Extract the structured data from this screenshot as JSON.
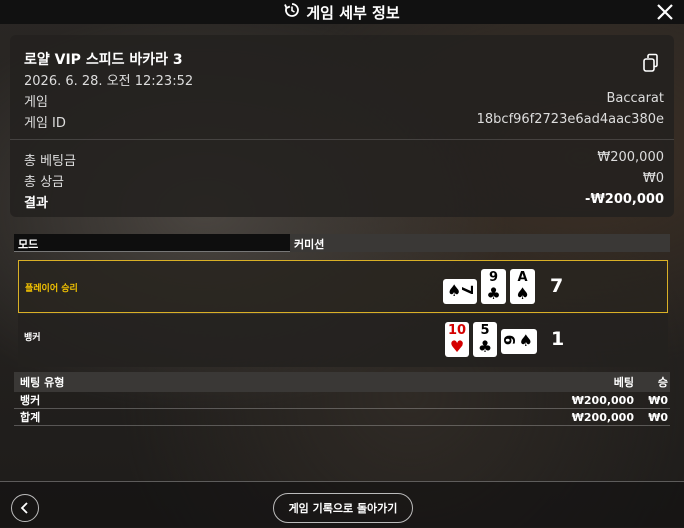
{
  "header": {
    "title": "게임 세부 정보",
    "history_icon": "history-icon",
    "close_icon": "close-icon"
  },
  "game": {
    "name": "로얄 VIP 스피드 바카라 3",
    "datetime": "2026. 6. 28. 오전 12:23:52",
    "game_label": "게임",
    "game_value": "Baccarat",
    "id_label": "게임 ID",
    "id_value": "18bcf96f2723e6ad4aac380e",
    "total_bet_label": "총 베팅금",
    "total_bet_value": "₩200,000",
    "total_win_label": "총 상금",
    "total_win_value": "₩0",
    "result_label": "결과",
    "result_value": "-₩200,000"
  },
  "tabs": {
    "mode": "모드",
    "commission": "커미션"
  },
  "hands": {
    "player": {
      "label": "플레이어 승리",
      "score": "7",
      "cards": [
        {
          "rank": "7",
          "suit": "♠",
          "color": "#000",
          "rotated": true
        },
        {
          "rank": "9",
          "suit": "♣",
          "color": "#000"
        },
        {
          "rank": "A",
          "suit": "♠",
          "color": "#000"
        }
      ]
    },
    "banker": {
      "label": "뱅커",
      "score": "1",
      "cards": [
        {
          "rank": "10",
          "suit": "♥",
          "color": "#d40000"
        },
        {
          "rank": "5",
          "suit": "♣",
          "color": "#000"
        },
        {
          "rank": "6",
          "suit": "♠",
          "color": "#000",
          "rotated": true
        }
      ]
    }
  },
  "bets": {
    "headers": {
      "type": "베팅 유형",
      "bet": "베팅",
      "win": "승"
    },
    "rows": [
      {
        "type": "뱅커",
        "bet": "₩200,000",
        "win": "₩0"
      },
      {
        "type": "합계",
        "bet": "₩200,000",
        "win": "₩0"
      }
    ]
  },
  "footer": {
    "back_icon": "chevron-left-icon",
    "history_button": "게임 기록으로 돌아가기"
  }
}
